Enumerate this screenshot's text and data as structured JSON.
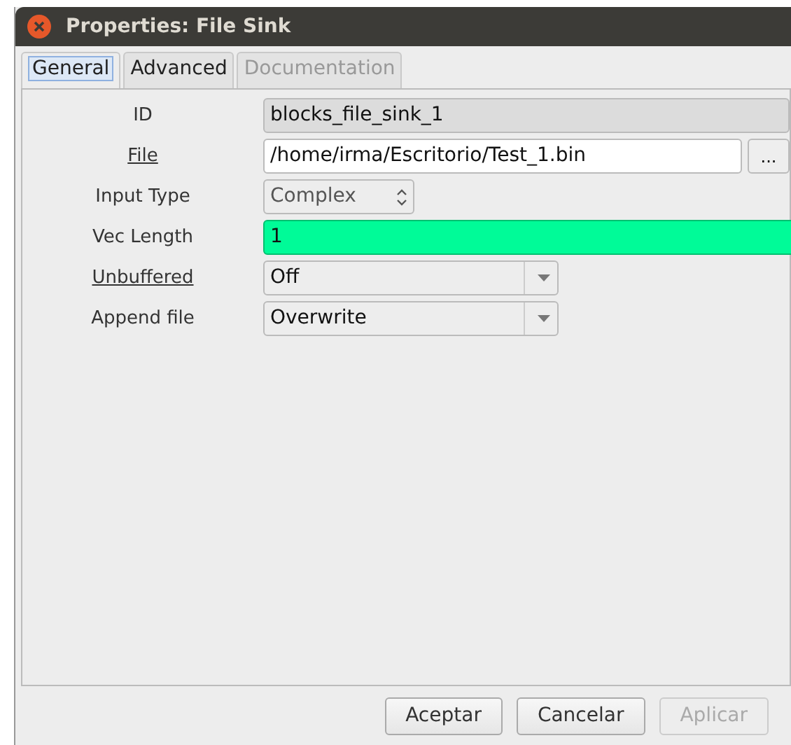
{
  "window": {
    "title": "Properties: File Sink"
  },
  "tabs": [
    {
      "label": "General",
      "selected": true,
      "disabled": false
    },
    {
      "label": "Advanced",
      "selected": false,
      "disabled": false
    },
    {
      "label": "Documentation",
      "selected": false,
      "disabled": true
    }
  ],
  "params": [
    {
      "label": "ID",
      "underlined": false,
      "kind": "readonly",
      "value": "blocks_file_sink_1",
      "highlighted": false
    },
    {
      "label": "File",
      "underlined": true,
      "kind": "file",
      "value": "/home/irma/Escritorio/Test_1.bin",
      "browse": "...",
      "highlighted": false
    },
    {
      "label": "Input Type",
      "underlined": false,
      "kind": "spin",
      "value": "Complex",
      "highlighted": false
    },
    {
      "label": "Vec Length",
      "underlined": false,
      "kind": "text",
      "value": "1",
      "highlighted": true
    },
    {
      "label": "Unbuffered",
      "underlined": true,
      "kind": "combo",
      "value": "Off",
      "highlighted": false
    },
    {
      "label": "Append file",
      "underlined": false,
      "kind": "combo",
      "value": "Overwrite",
      "highlighted": false
    }
  ],
  "buttons": [
    {
      "label": "Aceptar",
      "disabled": false
    },
    {
      "label": "Cancelar",
      "disabled": false
    },
    {
      "label": "Aplicar",
      "disabled": true
    }
  ]
}
